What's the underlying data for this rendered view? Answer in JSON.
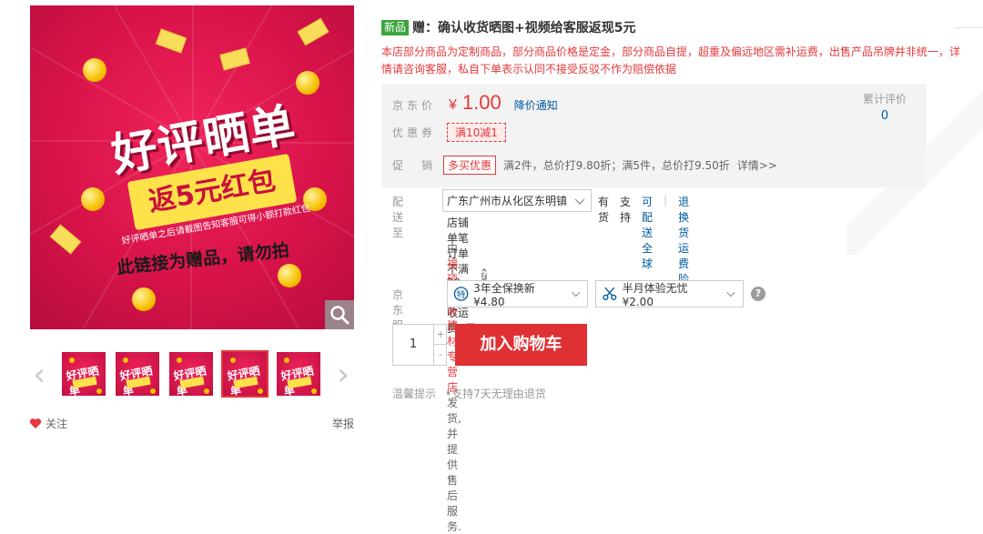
{
  "gallery": {
    "main_image": {
      "headline": "好评晒单",
      "reward": "返5元红包",
      "small_text": "好评晒单之后请截图告知客服可得小额打款红包",
      "note": "此链接为赠品，请勿拍"
    },
    "thumbs": [
      {
        "active": false
      },
      {
        "active": false
      },
      {
        "active": false
      },
      {
        "active": true
      },
      {
        "active": false
      }
    ],
    "thumb_headline": "好评晒单",
    "follow_label": "关注",
    "report_label": "举报"
  },
  "product": {
    "new_badge": "新品",
    "title": "赠：确认收货晒图+视频给客服返现5元",
    "notice": "本店部分商品为定制商品，部分商品价格是定金，部分商品自提，超重及偏远地区需补运费，出售产品吊牌并非统一，详情请咨询客服，私自下单表示认同不接受反驳不作为赔偿依据"
  },
  "price": {
    "label": "京东价",
    "currency": "¥",
    "amount": "1.00",
    "notify_label": "降价通知",
    "review_label": "累计评价",
    "review_count": "0",
    "coupon_label": "优惠券",
    "coupon_value": "满10减1",
    "promo_label": "促　销",
    "promo_tag": "多买优惠",
    "promo_desc": "满2件，总价打9.80折；满5件，总价打9.50折",
    "promo_detail": "详情>>"
  },
  "delivery": {
    "label": "配送至",
    "address": "广东广州市从化区东明镇",
    "stock": "有货",
    "support_label": "支持",
    "support_link1": "可配送全球",
    "separator": "|",
    "support_link2": "退换货运费险",
    "shipping_note": "店铺单笔订单不满29元，收运费5元",
    "seller_prefix": "由",
    "seller_name": "福硕家装建材专营店",
    "seller_suffix": "发货, 并提供售后服务."
  },
  "service": {
    "label": "京东服务",
    "option1": "3年全保换新 ¥4.80",
    "option2": "半月体验无忧 ¥2.00"
  },
  "purchase": {
    "quantity": "1",
    "plus": "+",
    "minus": "-",
    "add_cart_label": "加入购物车"
  },
  "tips": {
    "label": "温馨提示",
    "item1": "•支持7天无理由退货"
  },
  "colors": {
    "accent_red": "#e4393c",
    "link_blue": "#005aa0",
    "new_green": "#3ca53c"
  }
}
